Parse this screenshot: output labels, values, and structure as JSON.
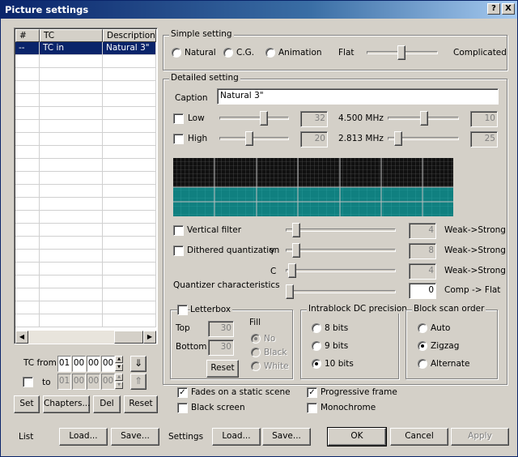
{
  "window": {
    "title": "Picture settings",
    "help_btn": "?",
    "close_btn": "X"
  },
  "list": {
    "columns": [
      "#",
      "TC",
      "Description"
    ],
    "rows": [
      {
        "num": "--",
        "tc": "TC in",
        "desc": "Natural 3\""
      }
    ],
    "scroll_left": "◀",
    "scroll_right": "▶"
  },
  "tc": {
    "from_label": "TC from",
    "to_label": "to",
    "from": [
      "01",
      "00",
      "00",
      "00"
    ],
    "to": [
      "01",
      "00",
      "00",
      "00"
    ],
    "from_enabled": true,
    "to_checked": false
  },
  "list_buttons": {
    "set": "Set",
    "chapters": "Chapters...",
    "del": "Del",
    "reset": "Reset"
  },
  "simple": {
    "legend": "Simple setting",
    "options": [
      "Natural",
      "C.G.",
      "Animation"
    ],
    "selected": null,
    "flat": "Flat",
    "complicated": "Complicated",
    "level": 0.5
  },
  "detailed": {
    "legend": "Detailed setting",
    "caption_label": "Caption",
    "caption_value": "Natural 3\"",
    "low": {
      "label": "Low",
      "checked": false,
      "value": "32",
      "freq": "4.500 MHz",
      "value2": "10"
    },
    "high": {
      "label": "High",
      "checked": false,
      "value": "20",
      "freq": "2.813 MHz",
      "value2": "25"
    },
    "vertical_filter": {
      "label": "Vertical filter",
      "checked": false,
      "value": "4",
      "hint": "Weak->Strong"
    },
    "dithered": {
      "label": "Dithered quantization",
      "checked": false,
      "y_label": "Y",
      "y_value": "8",
      "c_label": "C",
      "c_value": "4",
      "hint": "Weak->Strong"
    },
    "quantizer": {
      "label": "Quantizer characteristics",
      "value": "0",
      "hint": "Comp -> Flat"
    }
  },
  "letterbox": {
    "label": "Letterbox",
    "checked": false,
    "top_label": "Top",
    "top_value": "30",
    "bottom_label": "Bottom",
    "bottom_value": "30",
    "reset": "Reset",
    "fill_label": "Fill",
    "fill_options": [
      "No",
      "Black",
      "White"
    ],
    "fill_selected": "No"
  },
  "intrablock": {
    "legend": "Intrablock DC precision",
    "options": [
      "8 bits",
      "9 bits",
      "10 bits"
    ],
    "selected": "10 bits"
  },
  "scan": {
    "legend": "Block scan order",
    "options": [
      "Auto",
      "Zigzag",
      "Alternate"
    ],
    "selected": "Zigzag"
  },
  "flags": {
    "fades": {
      "label": "Fades on a static scene",
      "checked": true
    },
    "black_screen": {
      "label": "Black screen",
      "checked": false
    },
    "progressive": {
      "label": "Progressive frame",
      "checked": true
    },
    "monochrome": {
      "label": "Monochrome",
      "checked": false
    }
  },
  "footer": {
    "list_label": "List",
    "list_load": "Load...",
    "list_save": "Save...",
    "settings_label": "Settings",
    "settings_load": "Load...",
    "settings_save": "Save...",
    "ok": "OK",
    "cancel": "Cancel",
    "apply": "Apply"
  },
  "preview_colors": {
    "top": "#101010",
    "bottom": "#108080",
    "grid": "#606060"
  }
}
